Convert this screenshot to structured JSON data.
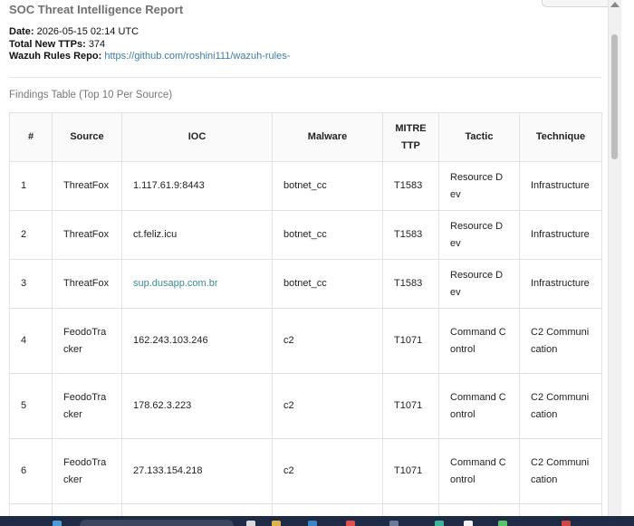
{
  "report": {
    "title": "SOC Threat Intelligence Report",
    "date_label": "Date:",
    "date_value": "2026-05-15 02:14 UTC",
    "ttps_label": "Total New TTPs:",
    "ttps_value": "374",
    "repo_label": "Wazuh Rules Repo:",
    "repo_link": "https://github.com/roshini111/wazuh-rules-"
  },
  "findings": {
    "heading": "Findings Table (Top 10 Per Source)",
    "columns": [
      "#",
      "Source",
      "IOC",
      "Malware",
      "MITRE TTP",
      "Tactic",
      "Technique"
    ],
    "rows": [
      {
        "num": "1",
        "source": "ThreatFox",
        "ioc": "1.117.61.9:8443",
        "malware": "botnet_cc",
        "ttp": "T1583",
        "tactic": "Resource Dev",
        "technique": "Infrastructure"
      },
      {
        "num": "2",
        "source": "ThreatFox",
        "ioc": "ct.feliz.icu",
        "malware": "botnet_cc",
        "ttp": "T1583",
        "tactic": "Resource Dev",
        "technique": "Infrastructure"
      },
      {
        "num": "3",
        "source": "ThreatFox",
        "ioc": "sup.dusapp.com.br",
        "malware": "botnet_cc",
        "ttp": "T1583",
        "tactic": "Resource Dev",
        "technique": "Infrastructure"
      },
      {
        "num": "4",
        "source": "FeodoTracker",
        "ioc": "162.243.103.246",
        "malware": "c2",
        "ttp": "T1071",
        "tactic": "Command Control",
        "technique": "C2 Communication"
      },
      {
        "num": "5",
        "source": "FeodoTracker",
        "ioc": "178.62.3.223",
        "malware": "c2",
        "ttp": "T1071",
        "tactic": "Command Control",
        "technique": "C2 Communication"
      },
      {
        "num": "6",
        "source": "FeodoTracker",
        "ioc": "27.133.154.218",
        "malware": "c2",
        "ttp": "T1071",
        "tactic": "Command Control",
        "technique": "C2 Communication"
      }
    ]
  },
  "colors": {
    "link": "#3b7fa4",
    "ioc_link": "#3b8a90",
    "heading_gray": "#707070",
    "taskbar": "#1f2a44"
  },
  "icons": [
    "scroll-up-arrow-icon",
    "taskbar-app-icon"
  ]
}
